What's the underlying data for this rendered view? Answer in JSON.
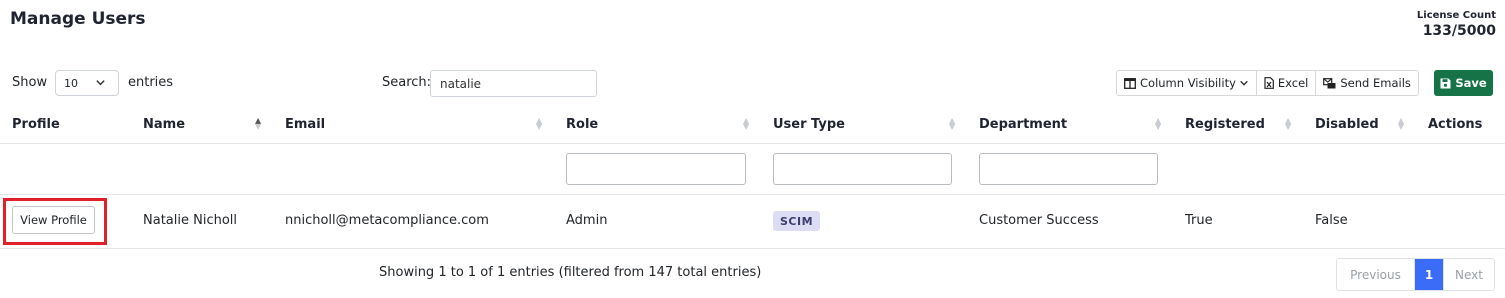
{
  "page": {
    "title": "Manage Users",
    "license_label": "License Count",
    "license_value": "133/5000"
  },
  "controls": {
    "show_label": "Show",
    "length_value": "10",
    "entries_label": "entries",
    "search_label": "Search:",
    "search_value": "natalie",
    "column_visibility_label": "Column Visibility",
    "excel_label": "Excel",
    "send_emails_label": "Send Emails",
    "save_label": "Save"
  },
  "table": {
    "columns": [
      "Profile",
      "Name",
      "Email",
      "Role",
      "User Type",
      "Department",
      "Registered",
      "Disabled",
      "Actions"
    ],
    "rows": [
      {
        "profile_button": "View Profile",
        "name": "Natalie Nicholl",
        "email": "nnicholl@metacompliance.com",
        "role": "Admin",
        "user_type": "SCIM",
        "department": "Customer Success",
        "registered": "True",
        "disabled": "False",
        "actions": ""
      }
    ]
  },
  "footer": {
    "info": "Showing 1 to 1 of 1 entries (filtered from 147 total entries)",
    "previous_label": "Previous",
    "current_page": "1",
    "next_label": "Next"
  },
  "colors": {
    "save_button": "#157347",
    "highlight": "#e0202b",
    "active_page": "#3b6cf7",
    "scim_badge": "#dcdcf5"
  },
  "icons": {
    "column_visibility": "columns-icon",
    "excel": "excel-file-icon",
    "send_emails": "send-mail-icon",
    "save": "floppy-disk-icon",
    "length_dropdown": "chevron-down-icon"
  }
}
